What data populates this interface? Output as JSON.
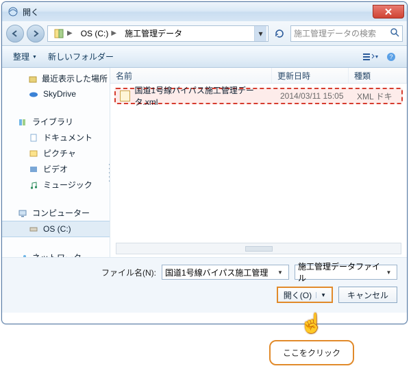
{
  "window": {
    "title": "開く"
  },
  "nav": {
    "back_icon": "left-arrow-icon",
    "fwd_icon": "right-arrow-icon"
  },
  "breadcrumb": {
    "seg1": "OS (C:)",
    "seg2": "施工管理データ"
  },
  "search": {
    "placeholder": "施工管理データの検索"
  },
  "toolbar": {
    "organize": "整理",
    "new_folder": "新しいフォルダー"
  },
  "navpane": {
    "recent": "最近表示した場所",
    "skydrive": "SkyDrive",
    "libraries": "ライブラリ",
    "documents": "ドキュメント",
    "pictures": "ピクチャ",
    "videos": "ビデオ",
    "music": "ミュージック",
    "computer": "コンピューター",
    "osc": "OS (C:)",
    "network": "ネットワーク"
  },
  "columns": {
    "name": "名前",
    "date": "更新日時",
    "type": "種類"
  },
  "files": [
    {
      "icon": "xml-file-icon",
      "name": "国道1号線バイパス施工管理データ.xml",
      "date": "2014/03/11 15:05",
      "type": "XML ドキ"
    }
  ],
  "filebar": {
    "label": "ファイル名(N):",
    "value": "国道1号線バイパス施工管理",
    "filter": "施工管理データファイル"
  },
  "buttons": {
    "open": "開く(O)",
    "cancel": "キャンセル"
  },
  "annotation": {
    "text": "ここをクリック"
  }
}
